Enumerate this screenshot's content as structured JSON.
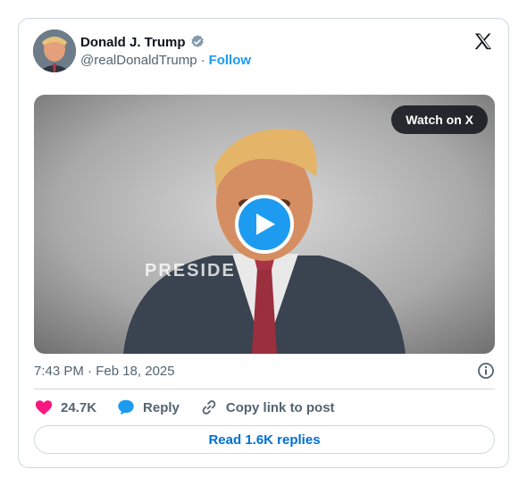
{
  "post": {
    "author": {
      "display_name": "Donald J. Trump",
      "handle": "@realDonaldTrump",
      "separator": "·",
      "follow_label": "Follow",
      "verified_icon": "verified-badge-icon"
    },
    "brand_icon": "x-logo-icon",
    "media": {
      "watch_label": "Watch on X",
      "overlay_text": "PRESIDE",
      "play_icon": "play-icon"
    },
    "timestamp": "7:43 PM · Feb 18, 2025",
    "info_icon": "info-icon",
    "actions": {
      "like_count": "24.7K",
      "reply_label": "Reply",
      "copy_label": "Copy link to post"
    },
    "read_replies_label": "Read 1.6K replies"
  },
  "colors": {
    "accent": "#1d9bf0",
    "like": "#f91880",
    "link": "#006fd6",
    "muted": "#536471",
    "border": "#cfd9de"
  }
}
